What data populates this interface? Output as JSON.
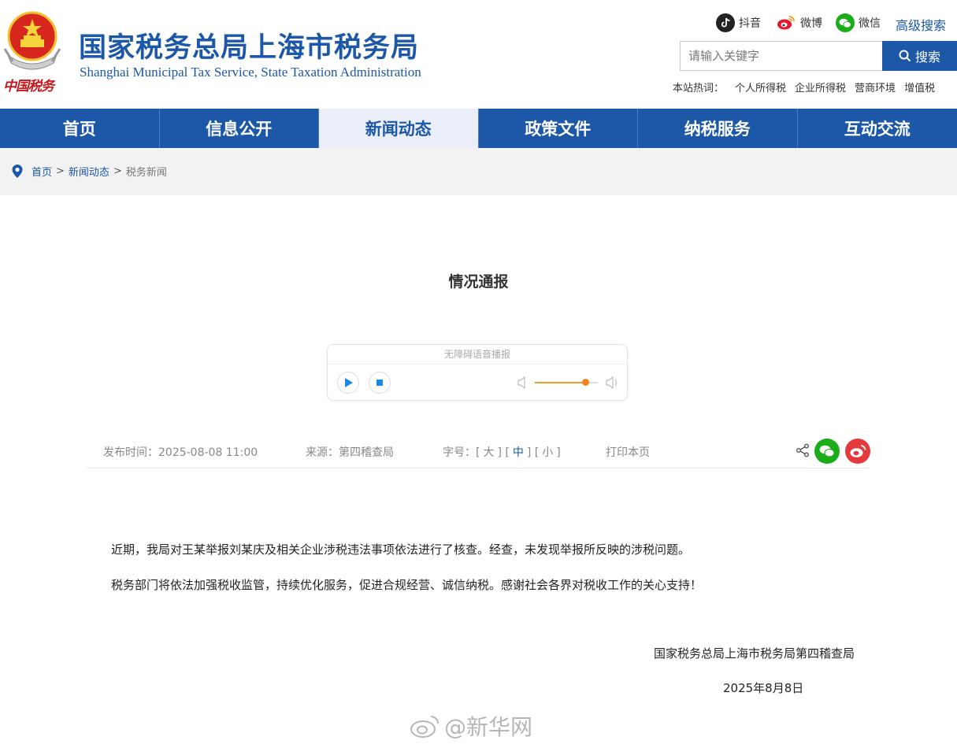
{
  "header": {
    "logo_text": "中国税务",
    "title": "国家税务总局上海市税务局",
    "subtitle": "Shanghai Municipal Tax Service, State Taxation Administration",
    "social": [
      {
        "label": "抖音",
        "icon": "douyin-icon",
        "color": "#222222"
      },
      {
        "label": "微博",
        "icon": "weibo-icon",
        "color": "#e6162d"
      },
      {
        "label": "微信",
        "icon": "wechat-icon",
        "color": "#1aad19"
      }
    ],
    "advanced_search": "高级搜索",
    "search_placeholder": "请输入关键字",
    "search_button": "搜索",
    "hot_label": "本站热词：",
    "hot_words": [
      "个人所得税",
      "企业所得税",
      "营商环境",
      "增值税"
    ]
  },
  "nav": {
    "items": [
      "首页",
      "信息公开",
      "新闻动态",
      "政策文件",
      "纳税服务",
      "互动交流"
    ],
    "active_index": 2
  },
  "breadcrumb": {
    "items": [
      "首页",
      "新闻动态",
      "税务新闻"
    ],
    "separator": ">"
  },
  "article": {
    "title": "情况通报",
    "player_label": "无障碍语音播报",
    "volume_level": 0.8,
    "publish_label": "发布时间：",
    "publish_time": "2025-08-08 11:00",
    "source_label": "来源：",
    "source": "第四稽查局",
    "fontsize_label": "字号：",
    "fontsize_options": [
      "大",
      "中",
      "小"
    ],
    "fontsize_selected": "中",
    "print_label": "打印本页",
    "paragraphs": [
      "近期，我局对王某举报刘某庆及相关企业涉税违法事项依法进行了核查。经查，未发现举报所反映的涉税问题。",
      "税务部门将依法加强税收监管，持续优化服务，促进合规经营、诚信纳税。感谢社会各界对税收工作的关心支持！"
    ],
    "signature": "国家税务总局上海市税务局第四稽查局",
    "date": "2025年8月8日"
  },
  "watermark": "@新华网",
  "colors": {
    "brand": "#1c57a8",
    "nav_active_bg": "#e9eef8",
    "accent_orange": "#f0841f"
  }
}
